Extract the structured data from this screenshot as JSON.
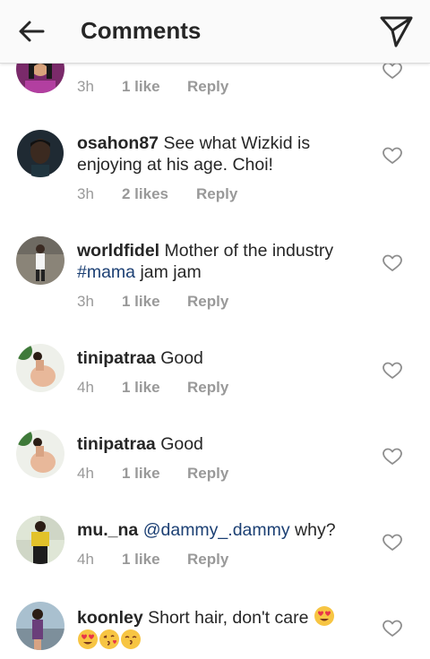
{
  "header": {
    "title": "Comments"
  },
  "comments": [
    {
      "username": "",
      "text": "",
      "time": "3h",
      "likes": "1 like",
      "reply": "Reply"
    },
    {
      "username": "osahon87",
      "text": "See what Wizkid is enjoying at his age. Choi!",
      "time": "3h",
      "likes": "2 likes",
      "reply": "Reply"
    },
    {
      "username": "worldfidel",
      "text": "Mother of the industry",
      "hashtag": "#mama",
      "text2": "jam jam",
      "time": "3h",
      "likes": "1 like",
      "reply": "Reply"
    },
    {
      "username": "tinipatraa",
      "text": "Good",
      "time": "4h",
      "likes": "1 like",
      "reply": "Reply"
    },
    {
      "username": "tinipatraa",
      "text": "Good",
      "time": "4h",
      "likes": "1 like",
      "reply": "Reply"
    },
    {
      "username": "mu._na",
      "mention": "@dammy_.dammy",
      "text": "why?",
      "time": "4h",
      "likes": "1 like",
      "reply": "Reply"
    },
    {
      "username": "koonley",
      "text": "Short hair, don't care",
      "emojis": [
        "heart-eyes-emoji",
        "heart-eyes-emoji",
        "kissing-heart-emoji",
        "kissing-smiling-emoji"
      ]
    }
  ],
  "icons": {
    "back": "arrow-left-icon",
    "send": "paper-plane-icon",
    "like": "heart-outline-icon"
  },
  "colors": {
    "text": "#262626",
    "meta": "#999999",
    "mention": "#1b3f73",
    "header_bg": "#fafafa"
  }
}
